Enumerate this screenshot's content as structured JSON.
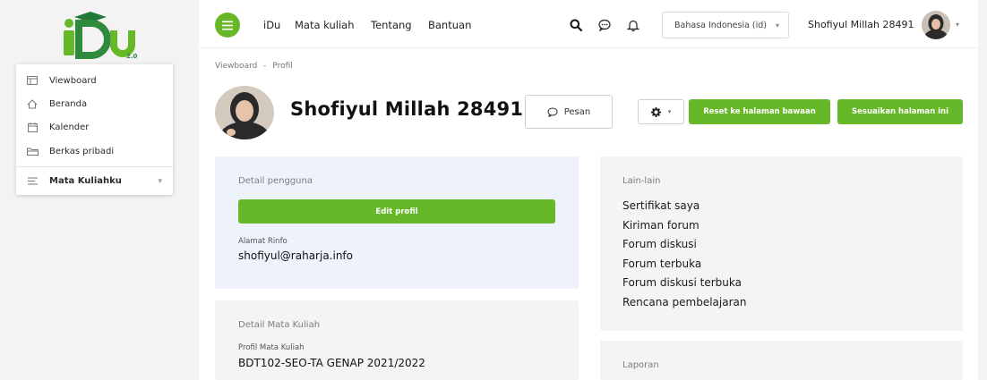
{
  "logo": {
    "text": "iDu",
    "version": "2.0"
  },
  "drawer": {
    "items": [
      {
        "label": "Viewboard",
        "icon": "viewboard-icon"
      },
      {
        "label": "Beranda",
        "icon": "home-icon"
      },
      {
        "label": "Kalender",
        "icon": "calendar-icon"
      },
      {
        "label": "Berkas pribadi",
        "icon": "folder-icon"
      }
    ],
    "section": {
      "label": "Mata Kuliahku",
      "icon": "list-icon"
    }
  },
  "topbar": {
    "nav": [
      "iDu",
      "Mata kuliah",
      "Tentang",
      "Bantuan"
    ],
    "language": "Bahasa Indonesia (id)",
    "user_name": "Shofiyul Millah 28491"
  },
  "breadcrumb": {
    "first": "Viewboard",
    "separator": "-",
    "second": "Profil"
  },
  "profile": {
    "name": "Shofiyul Millah 28491",
    "message_button": "Pesan",
    "reset_button": "Reset ke halaman bawaan",
    "customize_button": "Sesuaikan halaman ini"
  },
  "user_details": {
    "title": "Detail pengguna",
    "edit_button": "Edit profil",
    "email_label": "Alamat Rinfo",
    "email": "shofiyul@raharja.info"
  },
  "course_details": {
    "title": "Detail Mata Kuliah",
    "profile_label": "Profil Mata Kuliah",
    "course": "BDT102-SEO-TA GENAP 2021/2022"
  },
  "misc": {
    "title": "Lain-lain",
    "links": [
      "Sertifikat saya",
      "Kiriman forum",
      "Forum diskusi",
      "Forum terbuka",
      "Forum diskusi terbuka",
      "Rencana pembelajaran"
    ]
  },
  "reports": {
    "title": "Laporan"
  },
  "colors": {
    "accent": "#67b829",
    "card_blue": "#edf2fb",
    "card_grey": "#f4f4f4"
  }
}
